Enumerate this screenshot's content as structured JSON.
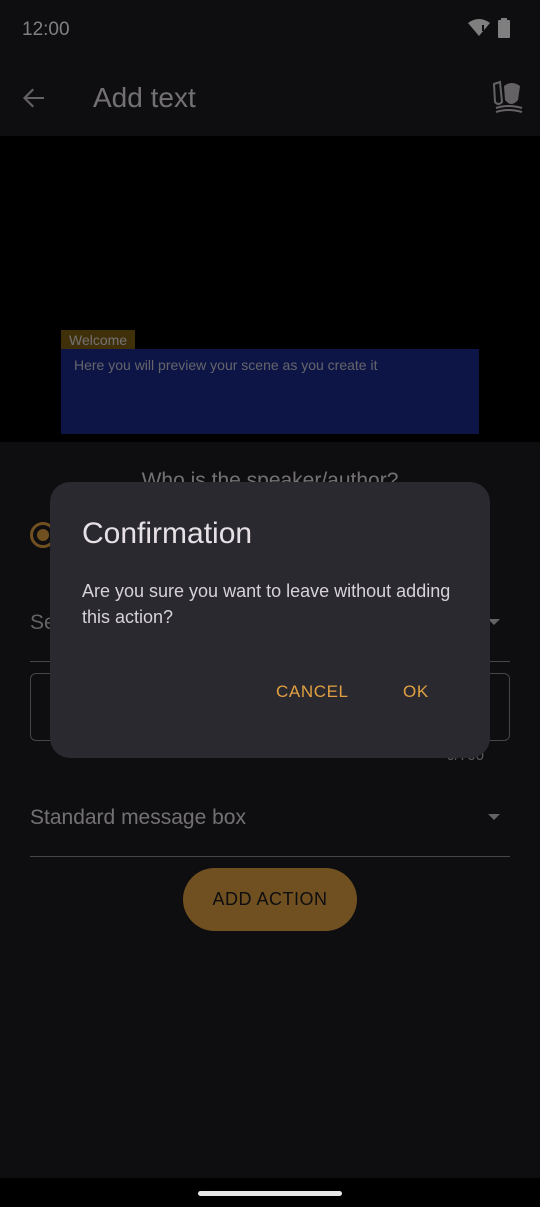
{
  "status_bar": {
    "time": "12:00"
  },
  "app_bar": {
    "title": "Add text",
    "icons": {
      "back": "arrow-left-icon",
      "scene": "theater-masks-icon"
    }
  },
  "preview": {
    "speaker_name": "Welcome",
    "message": "Here you will preview your scene as you create it"
  },
  "form": {
    "speaker_question": "Who is the speaker/author?",
    "speaker_select_partial": "Se",
    "char_counter": "0/700",
    "message_style": "Standard message box",
    "add_action_label": "ADD ACTION"
  },
  "dialog": {
    "title": "Confirmation",
    "body": "Are you sure you want to leave without adding this action?",
    "cancel_label": "CANCEL",
    "ok_label": "OK"
  },
  "colors": {
    "accent": "#e0a040",
    "dialog_bg": "#2b2930",
    "preview_box": "#1a2a8c",
    "name_tag": "#806014"
  }
}
